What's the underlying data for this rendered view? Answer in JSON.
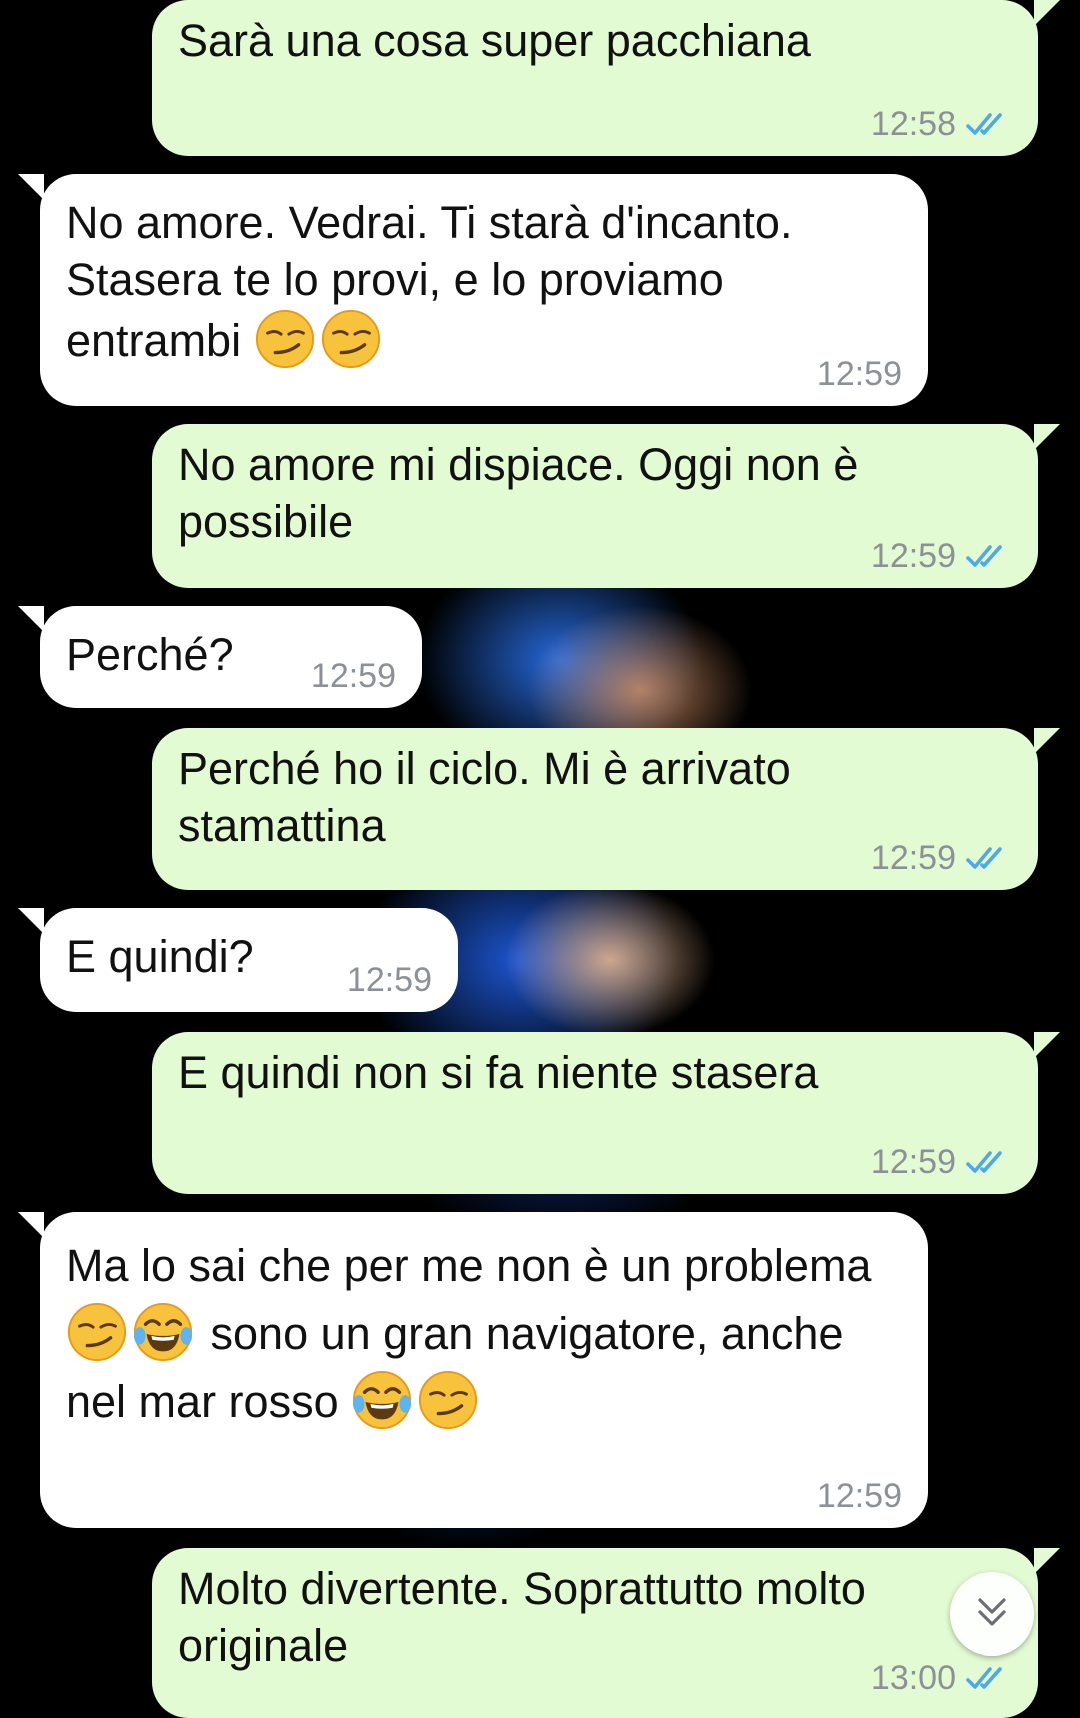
{
  "messages": [
    {
      "direction": "out",
      "text": "Sarà una cosa super pacchiana",
      "time": "12:58",
      "status": "read"
    },
    {
      "direction": "in",
      "text": "No amore. Vedrai. Ti starà d'incanto. Stasera te lo provi, e lo proviamo entrambi",
      "emojis": [
        "smirking-face",
        "smirking-face"
      ],
      "time": "12:59"
    },
    {
      "direction": "out",
      "text": "No amore mi dispiace. Oggi non è possibile",
      "time": "12:59",
      "status": "read"
    },
    {
      "direction": "in",
      "text": "Perché?",
      "time": "12:59"
    },
    {
      "direction": "out",
      "text": "Perché ho il ciclo. Mi è arrivato stamattina",
      "time": "12:59",
      "status": "read"
    },
    {
      "direction": "in",
      "text": "E quindi?",
      "time": "12:59"
    },
    {
      "direction": "out",
      "text": "E quindi non si fa niente stasera",
      "time": "12:59",
      "status": "read"
    },
    {
      "direction": "in",
      "text_parts": [
        "Ma lo sai che per me non è un problema",
        "sono un gran navigatore, anche nel mar rosso"
      ],
      "emojis": [
        "smirking-face",
        "face-with-tears-of-joy",
        "face-with-tears-of-joy",
        "smirking-face"
      ],
      "time": "12:59"
    },
    {
      "direction": "out",
      "text": "Molto divertente. Soprattutto molto originale",
      "time": "13:00",
      "status": "read"
    }
  ],
  "colors": {
    "outgoing_bubble": "#e3fbd3",
    "incoming_bubble": "#ffffff",
    "read_ticks": "#4fa8e8",
    "timestamp": "#8c9197"
  },
  "scroll_button": {
    "icon": "double-chevron-down-icon"
  }
}
